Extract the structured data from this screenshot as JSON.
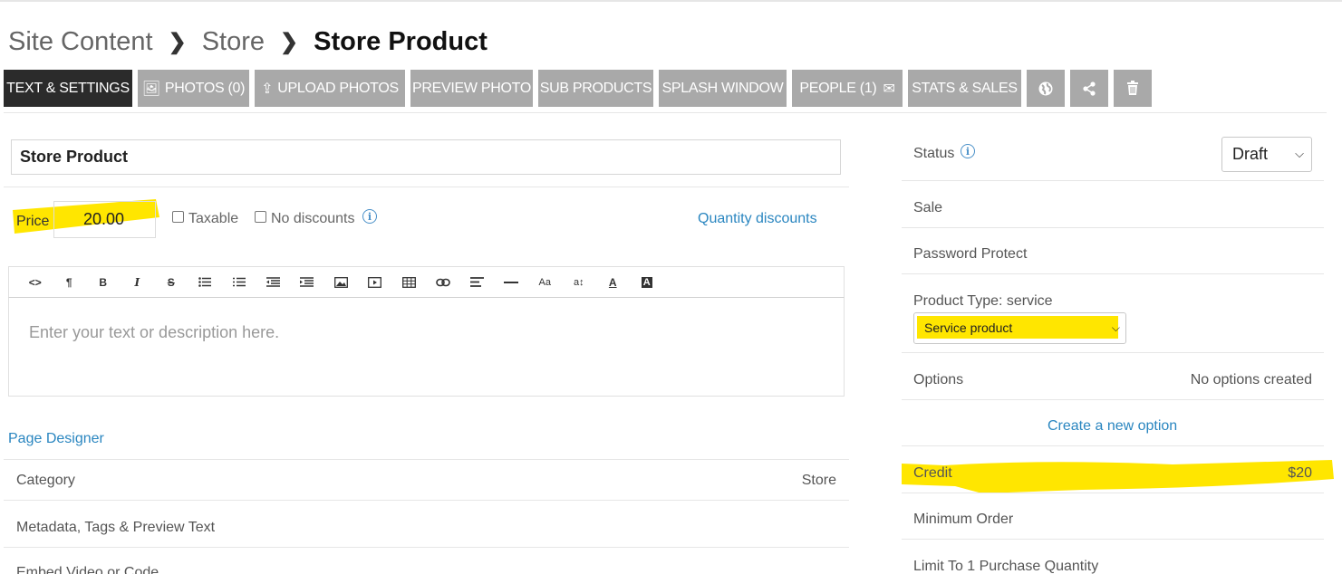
{
  "breadcrumb": {
    "items": [
      "Site Content",
      "Store"
    ],
    "separator": "›",
    "current": "Store Product"
  },
  "toolbar": {
    "text_settings": "TEXT & SETTINGS",
    "photos": "PHOTOS (0)",
    "upload_photos": "UPLOAD PHOTOS",
    "preview_photo": "PREVIEW PHOTO",
    "sub_products": "SUB PRODUCTS",
    "splash_window": "SPLASH WINDOW",
    "people": "PEOPLE (1)",
    "stats_sales": "STATS & SALES",
    "icons": [
      "globe-icon",
      "share-icon",
      "trash-icon"
    ]
  },
  "product": {
    "title": "Store Product",
    "price_label": "Price",
    "price_value": "20.00",
    "taxable_label": "Taxable",
    "no_discounts_label": "No discounts",
    "quantity_discounts_link": "Quantity discounts"
  },
  "editor": {
    "placeholder": "Enter your text or description here.",
    "tools": [
      "code-view",
      "paragraph",
      "bold",
      "italic",
      "strikethrough",
      "unordered-list",
      "ordered-list",
      "outdent",
      "indent",
      "image",
      "video",
      "table",
      "link",
      "align",
      "horizontal-rule",
      "font-size",
      "line-height",
      "text-color",
      "background-color"
    ]
  },
  "left_sections": {
    "page_designer_link": "Page Designer",
    "category_label": "Category",
    "category_value": "Store",
    "metadata_label": "Metadata, Tags & Preview Text",
    "embed_label": "Embed Video or Code"
  },
  "right_panel": {
    "status_label": "Status",
    "status_value": "Draft",
    "sale_label": "Sale",
    "password_label": "Password Protect",
    "product_type_label": "Product Type: service",
    "product_type_value": "Service product",
    "options_label": "Options",
    "options_value": "No options created",
    "create_option_link": "Create a new option",
    "credit_label": "Credit",
    "credit_value": "$20",
    "minimum_order_label": "Minimum Order",
    "limit_label": "Limit To 1 Purchase Quantity"
  },
  "colors": {
    "highlight": "#ffe600",
    "active_tab": "#2b2b2b",
    "inactive_tab": "#a9a9a9",
    "link": "#2a86c0"
  }
}
